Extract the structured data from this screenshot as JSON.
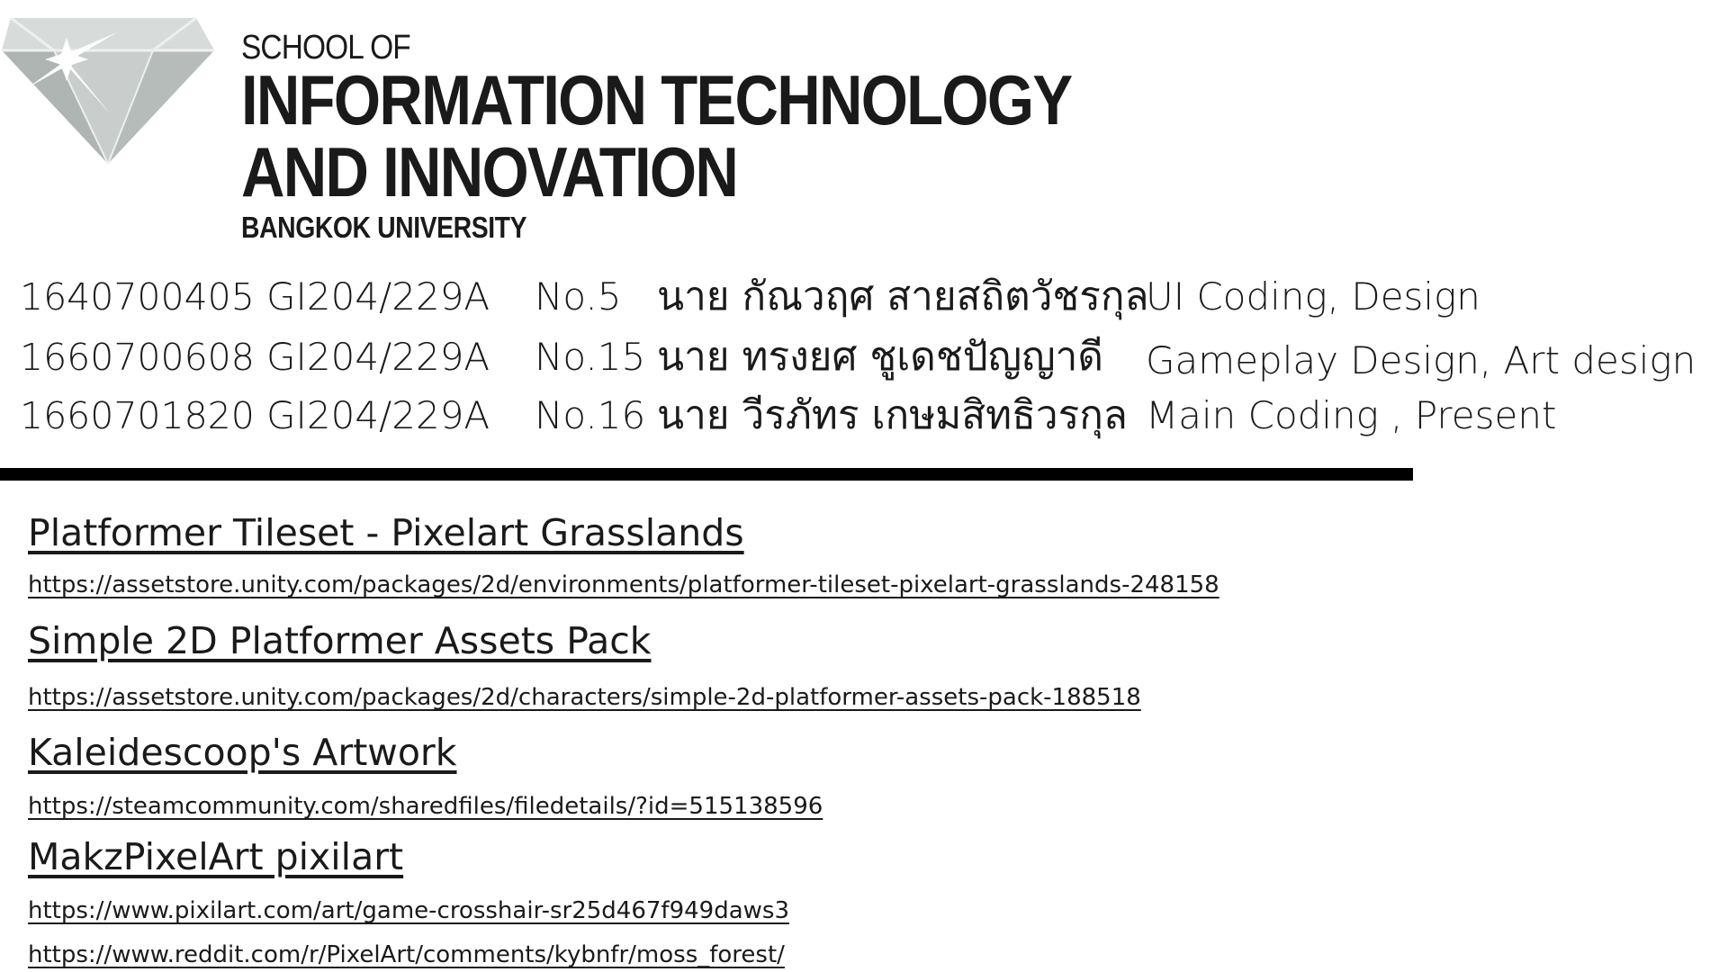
{
  "header": {
    "school_of": "SCHOOL OF",
    "line1": "INFORMATION TECHNOLOGY",
    "line2": "AND INNOVATION",
    "university": "BANGKOK UNIVERSITY"
  },
  "logo": {
    "icon": "diamond-logo-icon",
    "color": "#b8bfbd"
  },
  "members": [
    {
      "id": "1640700405",
      "class": "GI204/229A",
      "no": "No.5",
      "name": "นาย กัณวฤศ สายสถิตวัชรกุล",
      "role": "UI Coding, Design"
    },
    {
      "id": "1660700608",
      "class": "GI204/229A",
      "no": "No.15",
      "name": "นาย ทรงยศ ชูเดชปัญญาดี",
      "role": "Gameplay Design, Art design"
    },
    {
      "id": "1660701820",
      "class": "GI204/229A",
      "no": "No.16",
      "name": "นาย วีรภัทร เกษมสิทธิวรกุล",
      "role": "Main Coding , Present"
    }
  ],
  "references": [
    {
      "title": "Platformer Tileset - Pixelart Grasslands",
      "url": "https://assetstore.unity.com/packages/2d/environments/platformer-tileset-pixelart-grasslands-248158"
    },
    {
      "title": "Simple 2D Platformer Assets Pack",
      "url": "https://assetstore.unity.com/packages/2d/characters/simple-2d-platformer-assets-pack-188518"
    },
    {
      "title": "Kaleidescoop's Artwork",
      "url": "https://steamcommunity.com/sharedfiles/filedetails/?id=515138596"
    },
    {
      "title": "MakzPixelArt pixilart",
      "url": "https://www.pixilart.com/art/game-crosshair-sr25d467f949daws3"
    },
    {
      "title": "",
      "url": "https://www.reddit.com/r/PixelArt/comments/kybnfr/moss_forest/"
    }
  ]
}
